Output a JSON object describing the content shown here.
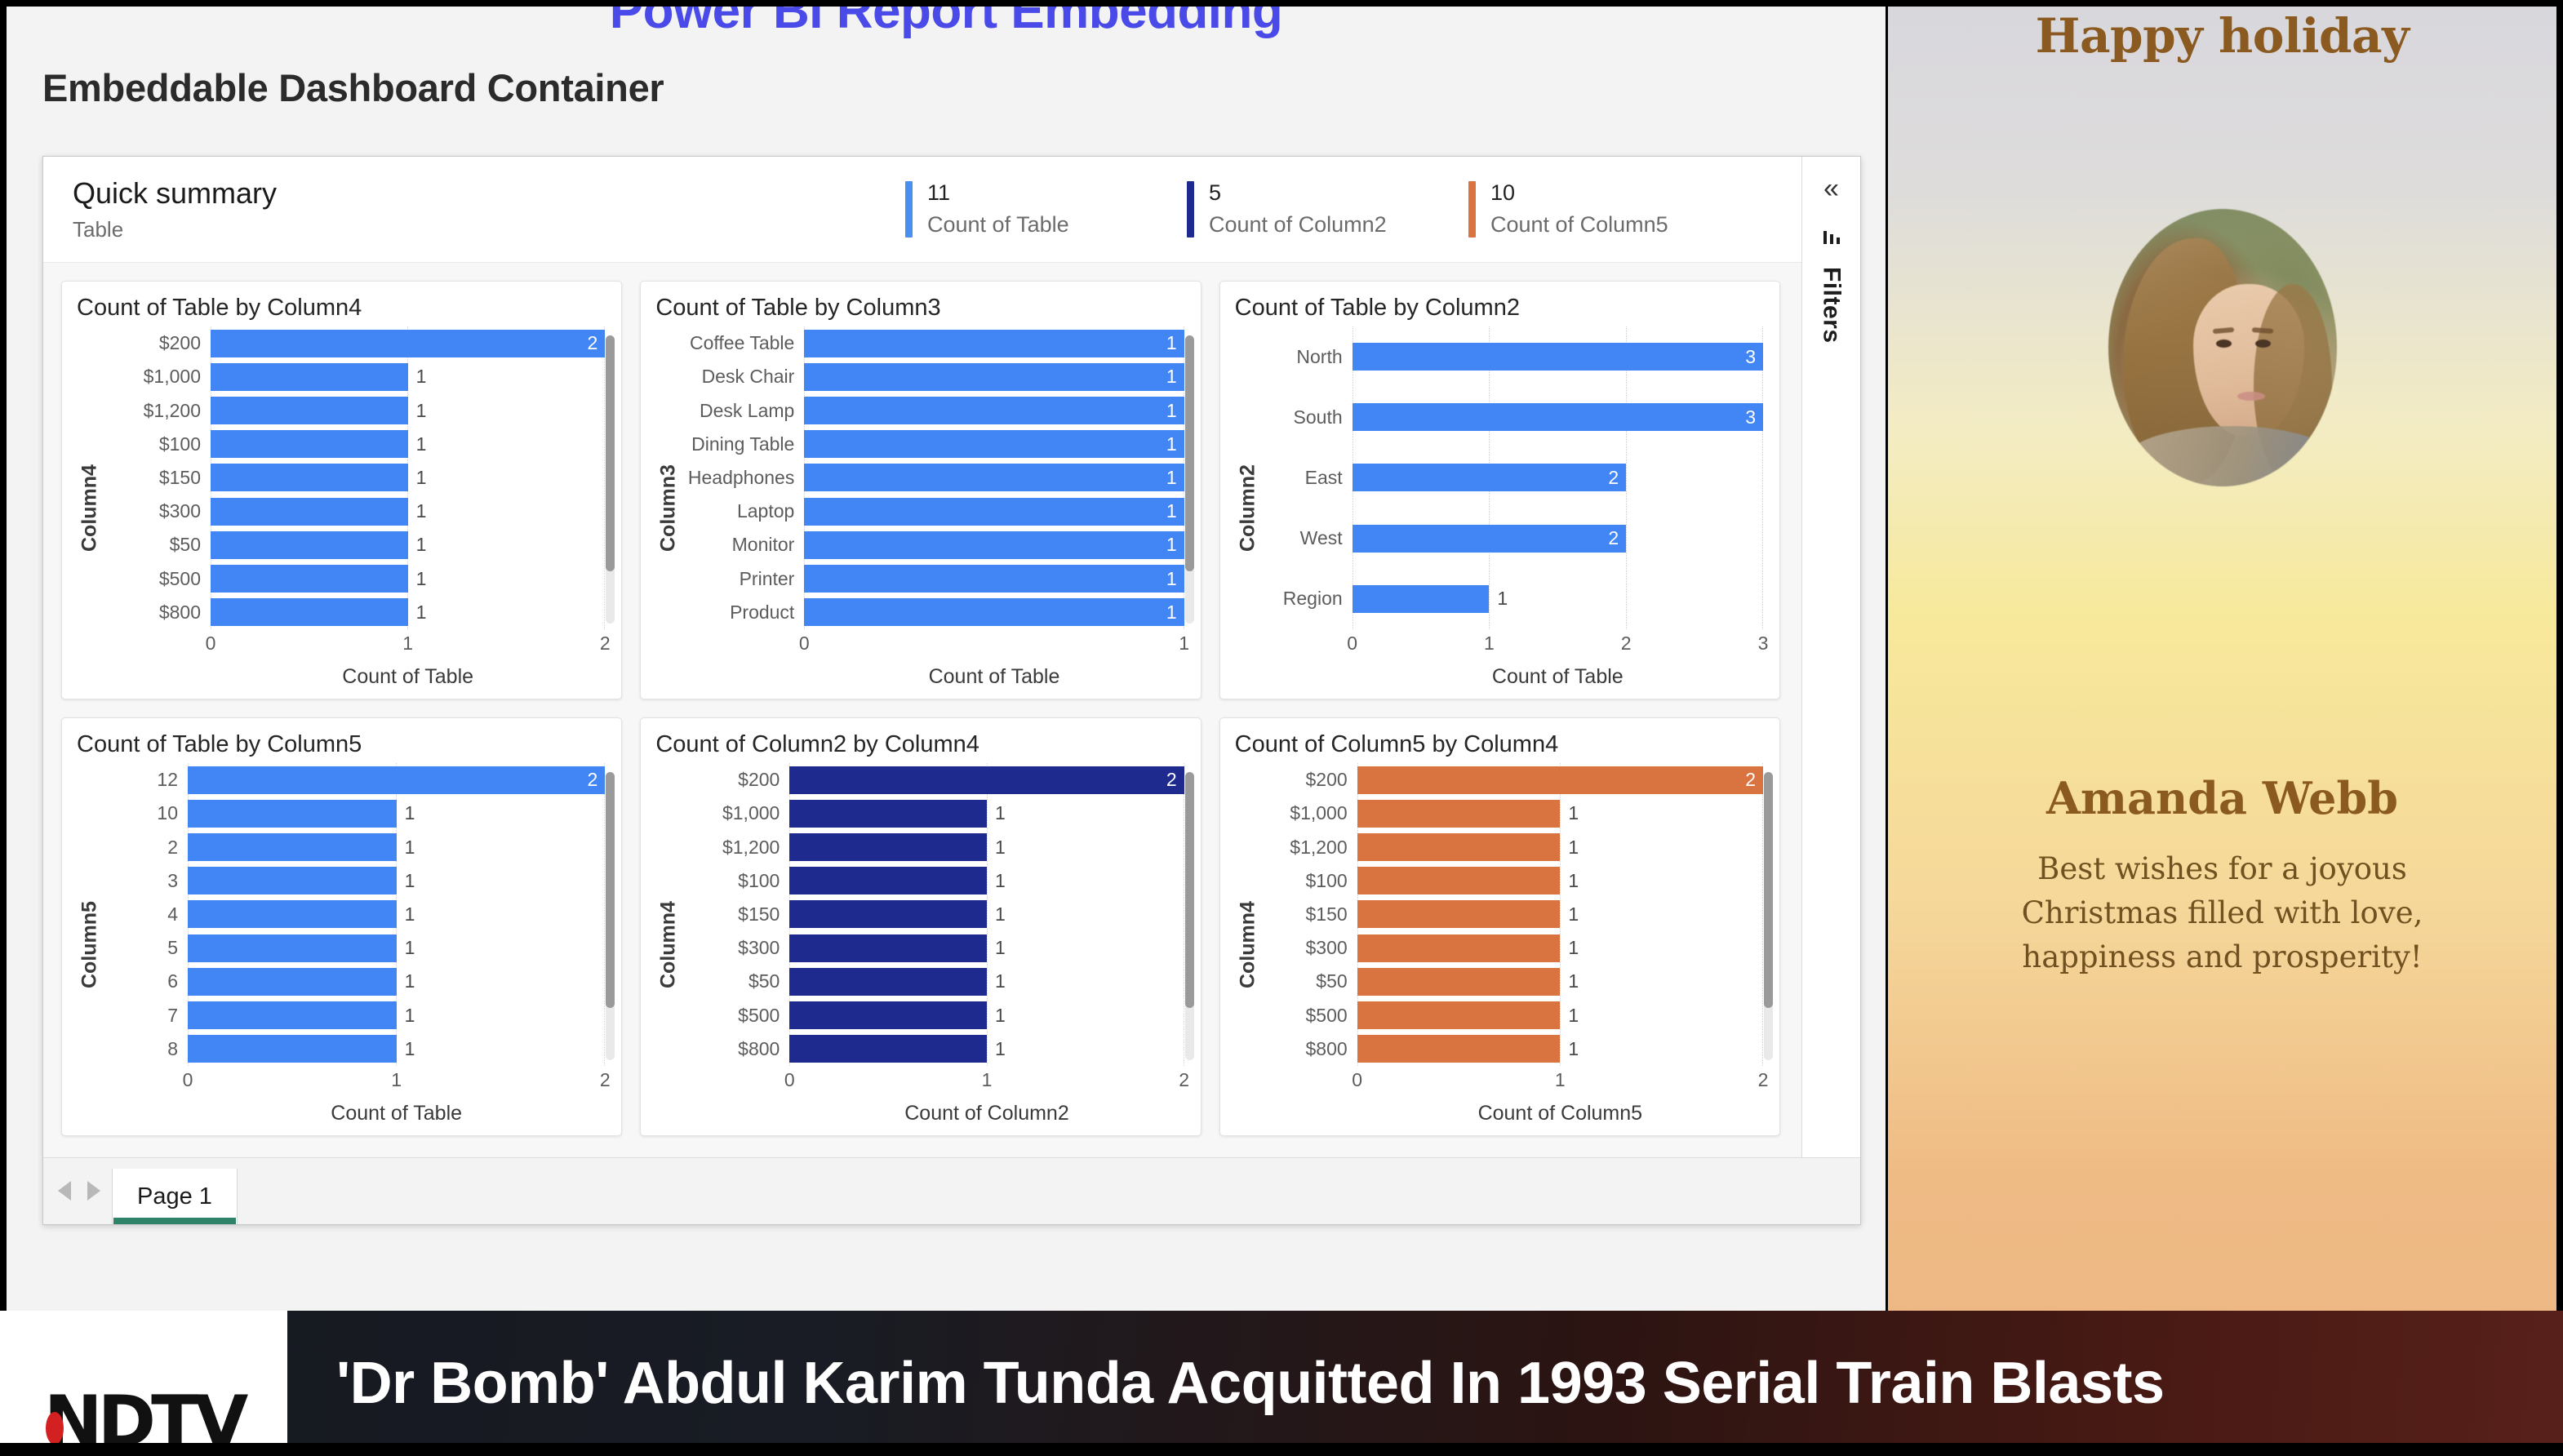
{
  "page": {
    "clipped_title": "Power BI Report Embedding",
    "heading": "Embeddable Dashboard Container"
  },
  "report": {
    "summary": {
      "title": "Quick summary",
      "subtitle": "Table",
      "kpis": [
        {
          "value": "11",
          "label": "Count of Table",
          "color": "#4a90f0"
        },
        {
          "value": "5",
          "label": "Count of Column2",
          "color": "#1f2a8f"
        },
        {
          "value": "10",
          "label": "Count of Column5",
          "color": "#d97441"
        }
      ]
    },
    "filters": {
      "collapse_icon": "«",
      "label": "Filters"
    },
    "pagebar": {
      "prev": "◁",
      "next": "▷",
      "tabs": [
        {
          "label": "Page 1",
          "active": true
        }
      ]
    }
  },
  "chart_data": [
    {
      "type": "bar",
      "orientation": "horizontal",
      "title": "Count of Table by Column4",
      "xlabel": "Count of Table",
      "ylabel": "Column4",
      "xlim": [
        0,
        2
      ],
      "xticks": [
        "0",
        "1",
        "2"
      ],
      "grid": true,
      "color": "#4285f4",
      "categories": [
        "$200",
        "$1,000",
        "$1,200",
        "$100",
        "$150",
        "$300",
        "$50",
        "$500",
        "$800"
      ],
      "values": [
        2,
        1,
        1,
        1,
        1,
        1,
        1,
        1,
        1
      ],
      "scrollbar": true
    },
    {
      "type": "bar",
      "orientation": "horizontal",
      "title": "Count of Table by Column3",
      "xlabel": "Count of Table",
      "ylabel": "Column3",
      "xlim": [
        0,
        1
      ],
      "xticks": [
        "0",
        "1"
      ],
      "grid": true,
      "color": "#4285f4",
      "categories": [
        "Coffee Table",
        "Desk Chair",
        "Desk Lamp",
        "Dining Table",
        "Headphones",
        "Laptop",
        "Monitor",
        "Printer",
        "Product"
      ],
      "values": [
        1,
        1,
        1,
        1,
        1,
        1,
        1,
        1,
        1
      ],
      "scrollbar": true
    },
    {
      "type": "bar",
      "orientation": "horizontal",
      "title": "Count of Table by Column2",
      "xlabel": "Count of Table",
      "ylabel": "Column2",
      "xlim": [
        0,
        3
      ],
      "xticks": [
        "0",
        "1",
        "2",
        "3"
      ],
      "grid": true,
      "color": "#4285f4",
      "categories": [
        "North",
        "South",
        "East",
        "West",
        "Region"
      ],
      "values": [
        3,
        3,
        2,
        2,
        1
      ],
      "scrollbar": false
    },
    {
      "type": "bar",
      "orientation": "horizontal",
      "title": "Count of Table by Column5",
      "xlabel": "Count of Table",
      "ylabel": "Column5",
      "xlim": [
        0,
        2
      ],
      "xticks": [
        "0",
        "1",
        "2"
      ],
      "grid": true,
      "color": "#4285f4",
      "categories": [
        "12",
        "10",
        "2",
        "3",
        "4",
        "5",
        "6",
        "7",
        "8"
      ],
      "values": [
        2,
        1,
        1,
        1,
        1,
        1,
        1,
        1,
        1
      ],
      "scrollbar": true
    },
    {
      "type": "bar",
      "orientation": "horizontal",
      "title": "Count of Column2 by Column4",
      "xlabel": "Count of Column2",
      "ylabel": "Column4",
      "xlim": [
        0,
        2
      ],
      "xticks": [
        "0",
        "1",
        "2"
      ],
      "grid": true,
      "color": "#1f2a8f",
      "categories": [
        "$200",
        "$1,000",
        "$1,200",
        "$100",
        "$150",
        "$300",
        "$50",
        "$500",
        "$800"
      ],
      "values": [
        2,
        1,
        1,
        1,
        1,
        1,
        1,
        1,
        1
      ],
      "scrollbar": true
    },
    {
      "type": "bar",
      "orientation": "horizontal",
      "title": "Count of Column5 by Column4",
      "xlabel": "Count of Column5",
      "ylabel": "Column4",
      "xlim": [
        0,
        2
      ],
      "xticks": [
        "0",
        "1",
        "2"
      ],
      "grid": true,
      "color": "#d97441",
      "categories": [
        "$200",
        "$1,000",
        "$1,200",
        "$100",
        "$150",
        "$300",
        "$50",
        "$500",
        "$800"
      ],
      "values": [
        2,
        1,
        1,
        1,
        1,
        1,
        1,
        1,
        1
      ],
      "scrollbar": true
    }
  ],
  "card": {
    "greeting": "Happy holiday",
    "name": "Amanda Webb",
    "message": "Best wishes for a joyous Christmas filled with love, happiness and prosperity!"
  },
  "ticker": {
    "logo": "NDTV",
    "headline": "'Dr Bomb' Abdul Karim Tunda Acquitted In 1993 Serial Train Blasts"
  }
}
